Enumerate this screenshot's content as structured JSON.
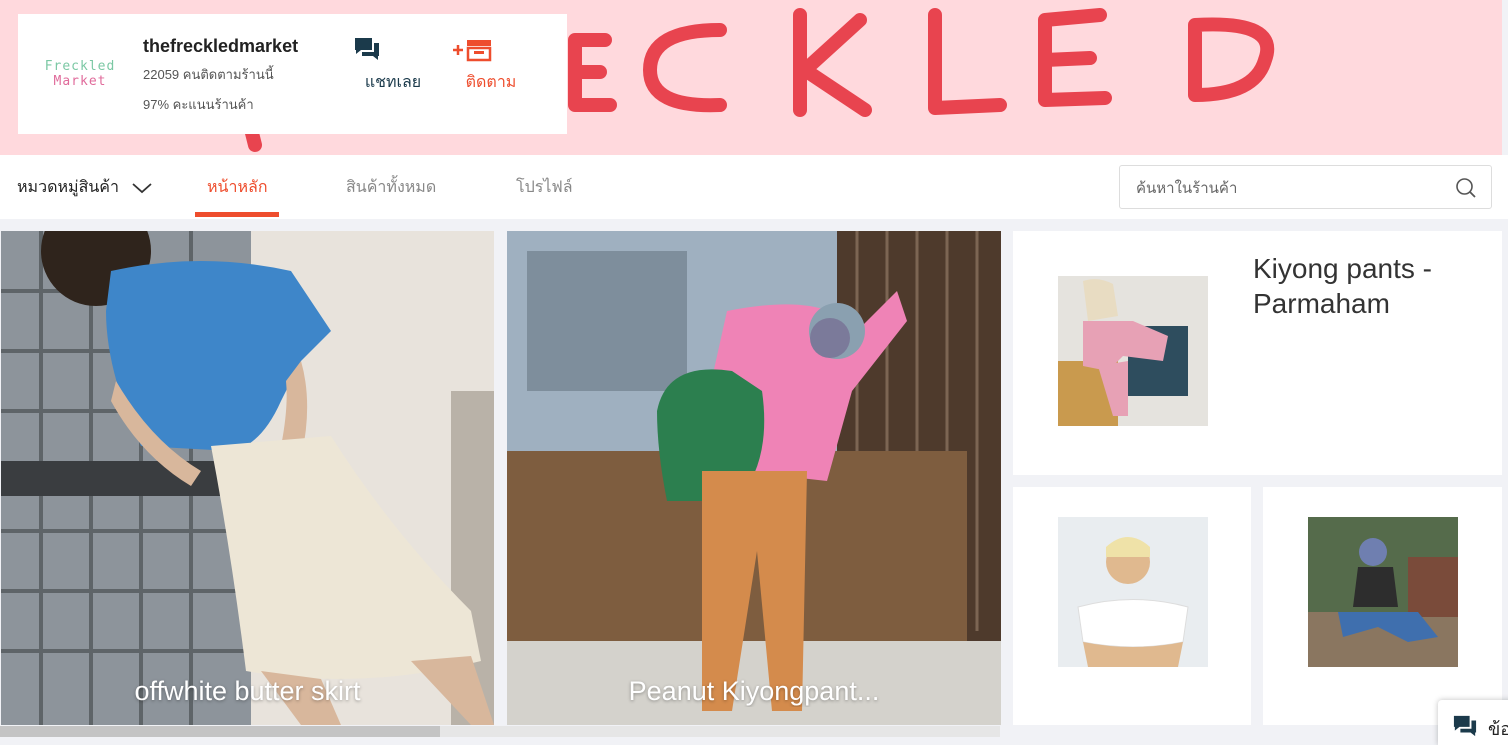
{
  "banner": {
    "bg_text": "ECKLED",
    "bg_color": "#ffd9dd",
    "text_color": "#e8444f"
  },
  "shop": {
    "logo_line1": "Freckled",
    "logo_line2": "Market",
    "name": "thefreckledmarket",
    "followers": "22059 คนติดตามร้านนี้",
    "rating": "97% คะแนนร้านค้า",
    "chat_label": "แชทเลย",
    "chat_icon": "chat-bubbles-icon",
    "follow_label": "ติดตาม",
    "follow_icon": "plus-store-icon"
  },
  "nav": {
    "category_label": "หมวดหมู่สินค้า",
    "tabs": [
      {
        "label": "หน้าหลัก",
        "active": true
      },
      {
        "label": "สินค้าทั้งหมด",
        "active": false
      },
      {
        "label": "โปรไฟล์",
        "active": false
      }
    ],
    "search_placeholder": "ค้นหาในร้านค้า",
    "accent": "#ee4d2d"
  },
  "products": {
    "tile1_caption": "offwhite butter skirt",
    "tile2_caption": "Peanut Kiyongpant...",
    "featured_title": "Kiyong pants - Parmaham"
  },
  "chat_widget": {
    "label": "ข้อ"
  }
}
